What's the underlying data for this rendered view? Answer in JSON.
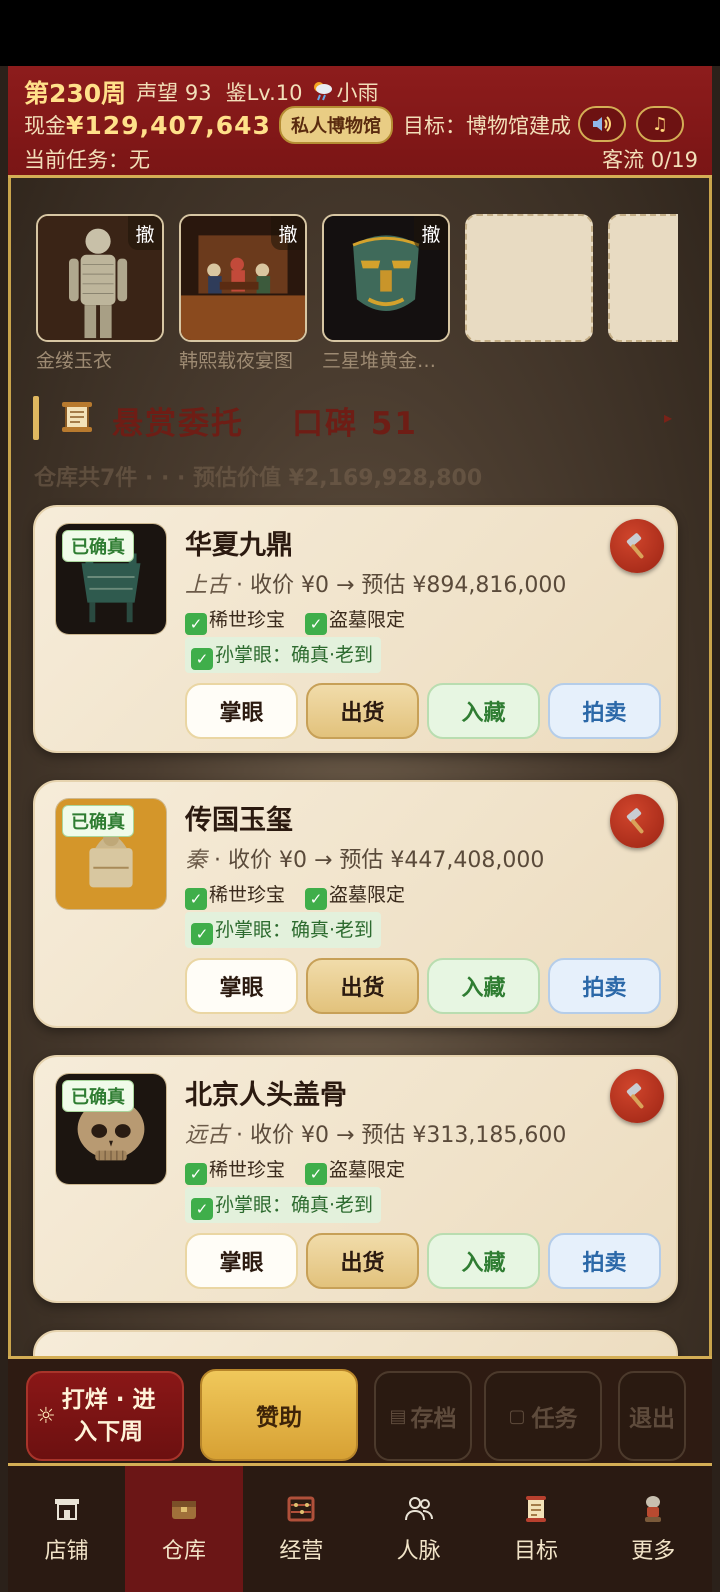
{
  "header": {
    "week": "第230周",
    "reputation": "声望 93",
    "appraisal_level": "鉴Lv.10",
    "weather_icon": "rain-cloud-icon",
    "weather": "小雨",
    "money_label": "现金",
    "money": "¥129,407,643",
    "museum_badge": "私人博物馆",
    "goal": "目标：博物馆建成",
    "task": "当前任务：无",
    "traffic": "客流 0/19"
  },
  "shelf": {
    "items": [
      {
        "name": "金缕玉衣",
        "revoke": "撤"
      },
      {
        "name": "韩熙载夜宴图",
        "revoke": "撤"
      },
      {
        "name": "三星堆黄金…",
        "revoke": "撤"
      }
    ]
  },
  "section": {
    "title": "悬赏委托",
    "reputation": "口碑 51",
    "faded_line": "仓库共7件  · · ·  预估价值 ¥2,169,928,800"
  },
  "cards": [
    {
      "verified": "已确真",
      "name": "华夏九鼎",
      "era": "上古",
      "price": " · 收价 ¥0 → 预估 ¥894,816,000",
      "tag1": "稀世珍宝",
      "tag2": "盗墓限定",
      "appraisal": "孙掌眼：确真·老到"
    },
    {
      "verified": "已确真",
      "name": "传国玉玺",
      "era": "秦",
      "price": " · 收价 ¥0 → 预估 ¥447,408,000",
      "tag1": "稀世珍宝",
      "tag2": "盗墓限定",
      "appraisal": "孙掌眼：确真·老到"
    },
    {
      "verified": "已确真",
      "name": "北京人头盖骨",
      "era": "远古",
      "price": " · 收价 ¥0 → 预估 ¥313,185,600",
      "tag1": "稀世珍宝",
      "tag2": "盗墓限定",
      "appraisal": "孙掌眼：确真·老到"
    }
  ],
  "buttons": {
    "view": "掌眼",
    "ship": "出货",
    "collect": "入藏",
    "auction": "拍卖"
  },
  "action_bar": {
    "advance_line1": "打烊 · 进",
    "advance_line2": "入下周",
    "sponsor": "赞助",
    "save": "存档",
    "tasks": "任务",
    "exit": "退出"
  },
  "nav": [
    {
      "label": "店铺",
      "icon": "shop-icon"
    },
    {
      "label": "仓库",
      "icon": "warehouse-icon"
    },
    {
      "label": "经营",
      "icon": "abacus-icon"
    },
    {
      "label": "人脉",
      "icon": "people-icon"
    },
    {
      "label": "目标",
      "icon": "scroll-target-icon"
    },
    {
      "label": "更多",
      "icon": "more-icon"
    }
  ],
  "active_nav": "仓库",
  "colors": {
    "header_red": "#8d1c1c",
    "gold": "#d4ae55",
    "card_bg": "#f6ecd9",
    "verified_green": "#2f7d32",
    "auction_blue": "#2b68a8"
  }
}
